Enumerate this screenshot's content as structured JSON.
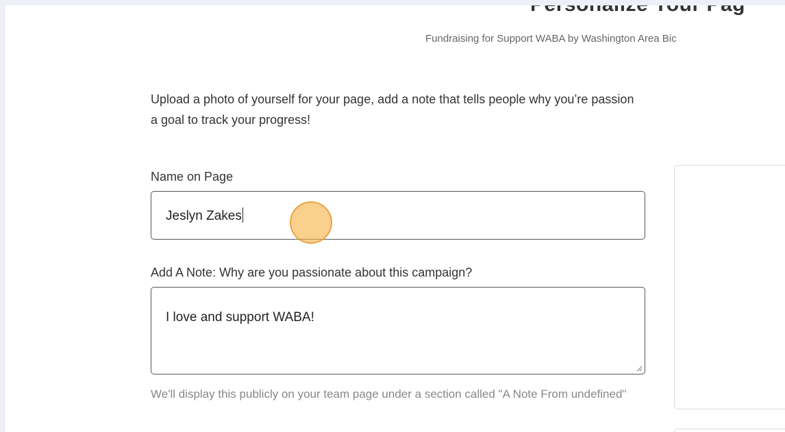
{
  "header": {
    "title": "Personalize Your Pag",
    "subtitle": "Fundraising for Support WABA by Washington Area Bic"
  },
  "intro": {
    "line1": "Upload a photo of yourself for your page, add a note that tells people why you’re passion",
    "line2": "a goal to track your progress!"
  },
  "form": {
    "name_label": "Name on Page",
    "name_value": "Jeslyn Zakes",
    "note_label": "Add A Note: Why are you passionate about this campaign?",
    "note_value": "I love and support WABA!",
    "note_help": "We'll display this publicly on your team page under a section called \"A Note From undefined\""
  },
  "colors": {
    "page_background": "#ffffff",
    "outer_background": "#eef0f8",
    "click_marker": "#f5b041"
  }
}
